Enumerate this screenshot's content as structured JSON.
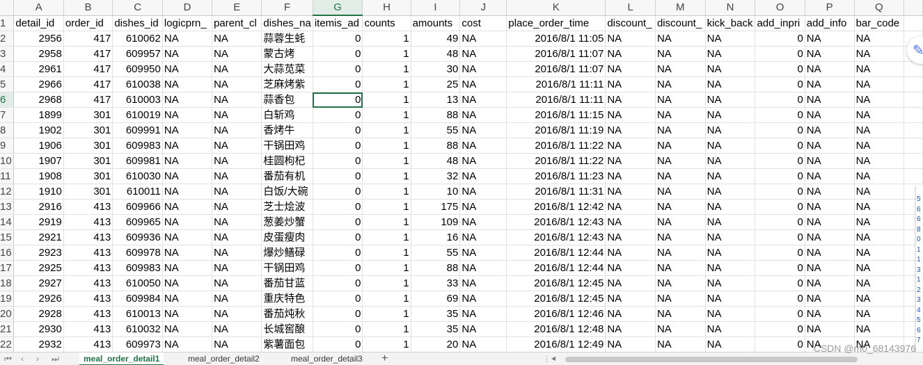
{
  "columns": [
    "A",
    "B",
    "C",
    "D",
    "E",
    "F",
    "G",
    "H",
    "I",
    "J",
    "K",
    "L",
    "M",
    "N",
    "O",
    "P",
    "Q"
  ],
  "active_column": "G",
  "headers": [
    "detail_id",
    "order_id",
    "dishes_id",
    "logicprn_",
    "parent_cl",
    "dishes_na",
    "itemis_ad",
    "counts",
    "amounts",
    "cost",
    "place_order_time",
    "discount_",
    "discount_",
    "kick_back",
    "add_inpri",
    "add_info",
    "bar_code"
  ],
  "rows": [
    {
      "n": "2",
      "cells": [
        "2956",
        "417",
        "610062",
        "NA",
        "NA",
        "蒜蓉生蚝",
        "0",
        "1",
        "49",
        "NA",
        "2016/8/1 11:05",
        "NA",
        "NA",
        "NA",
        "0",
        "NA",
        "NA"
      ]
    },
    {
      "n": "3",
      "cells": [
        "2958",
        "417",
        "609957",
        "NA",
        "NA",
        "蒙古烤",
        "0",
        "1",
        "48",
        "NA",
        "2016/8/1 11:07",
        "NA",
        "NA",
        "NA",
        "0",
        "NA",
        "NA"
      ]
    },
    {
      "n": "4",
      "cells": [
        "2961",
        "417",
        "609950",
        "NA",
        "NA",
        "大蒜苋菜",
        "0",
        "1",
        "30",
        "NA",
        "2016/8/1 11:07",
        "NA",
        "NA",
        "NA",
        "0",
        "NA",
        "NA"
      ]
    },
    {
      "n": "5",
      "cells": [
        "2966",
        "417",
        "610038",
        "NA",
        "NA",
        "芝麻烤紫",
        "0",
        "1",
        "25",
        "NA",
        "2016/8/1 11:11",
        "NA",
        "NA",
        "NA",
        "0",
        "NA",
        "NA"
      ]
    },
    {
      "n": "6",
      "cells": [
        "2968",
        "417",
        "610003",
        "NA",
        "NA",
        "蒜香包",
        "0",
        "1",
        "13",
        "NA",
        "2016/8/1 11:11",
        "NA",
        "NA",
        "NA",
        "0",
        "NA",
        "NA"
      ]
    },
    {
      "n": "7",
      "cells": [
        "1899",
        "301",
        "610019",
        "NA",
        "NA",
        "白斩鸡",
        "0",
        "1",
        "88",
        "NA",
        "2016/8/1 11:15",
        "NA",
        "NA",
        "NA",
        "0",
        "NA",
        "NA"
      ]
    },
    {
      "n": "8",
      "cells": [
        "1902",
        "301",
        "609991",
        "NA",
        "NA",
        "香烤牛",
        "0",
        "1",
        "55",
        "NA",
        "2016/8/1 11:19",
        "NA",
        "NA",
        "NA",
        "0",
        "NA",
        "NA"
      ]
    },
    {
      "n": "9",
      "cells": [
        "1906",
        "301",
        "609983",
        "NA",
        "NA",
        "干锅田鸡",
        "0",
        "1",
        "88",
        "NA",
        "2016/8/1 11:22",
        "NA",
        "NA",
        "NA",
        "0",
        "NA",
        "NA"
      ]
    },
    {
      "n": "10",
      "cells": [
        "1907",
        "301",
        "609981",
        "NA",
        "NA",
        "桂圆枸杞",
        "0",
        "1",
        "48",
        "NA",
        "2016/8/1 11:22",
        "NA",
        "NA",
        "NA",
        "0",
        "NA",
        "NA"
      ]
    },
    {
      "n": "11",
      "cells": [
        "1908",
        "301",
        "610030",
        "NA",
        "NA",
        "番茄有机",
        "0",
        "1",
        "32",
        "NA",
        "2016/8/1 11:23",
        "NA",
        "NA",
        "NA",
        "0",
        "NA",
        "NA"
      ]
    },
    {
      "n": "12",
      "cells": [
        "1910",
        "301",
        "610011",
        "NA",
        "NA",
        "白饭/大碗",
        "0",
        "1",
        "10",
        "NA",
        "2016/8/1 11:31",
        "NA",
        "NA",
        "NA",
        "0",
        "NA",
        "NA"
      ]
    },
    {
      "n": "13",
      "cells": [
        "2916",
        "413",
        "609966",
        "NA",
        "NA",
        "芝士烩波",
        "0",
        "1",
        "175",
        "NA",
        "2016/8/1 12:42",
        "NA",
        "NA",
        "NA",
        "0",
        "NA",
        "NA"
      ]
    },
    {
      "n": "14",
      "cells": [
        "2919",
        "413",
        "609965",
        "NA",
        "NA",
        "葱姜炒蟹",
        "0",
        "1",
        "109",
        "NA",
        "2016/8/1 12:43",
        "NA",
        "NA",
        "NA",
        "0",
        "NA",
        "NA"
      ]
    },
    {
      "n": "15",
      "cells": [
        "2921",
        "413",
        "609936",
        "NA",
        "NA",
        "皮蛋瘦肉",
        "0",
        "1",
        "16",
        "NA",
        "2016/8/1 12:43",
        "NA",
        "NA",
        "NA",
        "0",
        "NA",
        "NA"
      ]
    },
    {
      "n": "16",
      "cells": [
        "2923",
        "413",
        "609978",
        "NA",
        "NA",
        "爆炒鳝碌",
        "0",
        "1",
        "55",
        "NA",
        "2016/8/1 12:44",
        "NA",
        "NA",
        "NA",
        "0",
        "NA",
        "NA"
      ]
    },
    {
      "n": "17",
      "cells": [
        "2925",
        "413",
        "609983",
        "NA",
        "NA",
        "干锅田鸡",
        "0",
        "1",
        "88",
        "NA",
        "2016/8/1 12:44",
        "NA",
        "NA",
        "NA",
        "0",
        "NA",
        "NA"
      ]
    },
    {
      "n": "18",
      "cells": [
        "2927",
        "413",
        "610050",
        "NA",
        "NA",
        "番茄甘蓝",
        "0",
        "1",
        "33",
        "NA",
        "2016/8/1 12:45",
        "NA",
        "NA",
        "NA",
        "0",
        "NA",
        "NA"
      ]
    },
    {
      "n": "19",
      "cells": [
        "2926",
        "413",
        "609984",
        "NA",
        "NA",
        "重庆特色",
        "0",
        "1",
        "69",
        "NA",
        "2016/8/1 12:45",
        "NA",
        "NA",
        "NA",
        "0",
        "NA",
        "NA"
      ]
    },
    {
      "n": "20",
      "cells": [
        "2928",
        "413",
        "610013",
        "NA",
        "NA",
        "番茄炖秋",
        "0",
        "1",
        "35",
        "NA",
        "2016/8/1 12:46",
        "NA",
        "NA",
        "NA",
        "0",
        "NA",
        "NA"
      ]
    },
    {
      "n": "21",
      "cells": [
        "2930",
        "413",
        "610032",
        "NA",
        "NA",
        "长城窖酿",
        "0",
        "1",
        "35",
        "NA",
        "2016/8/1 12:48",
        "NA",
        "NA",
        "NA",
        "0",
        "NA",
        "NA"
      ]
    },
    {
      "n": "22",
      "cells": [
        "2932",
        "413",
        "609973",
        "NA",
        "NA",
        "紫薯面包",
        "0",
        "1",
        "20",
        "NA",
        "2016/8/1 12:49",
        "NA",
        "NA",
        "NA",
        "0",
        "NA",
        "NA"
      ]
    }
  ],
  "header_row_num": "1",
  "selected_row": "6",
  "selected_col_index": 6,
  "sheet_tabs": [
    "meal_order_detail1",
    "meal_order_detail2",
    "meal_order_detail3"
  ],
  "active_tab": "meal_order_detail1",
  "add_tab_label": "+",
  "watermark": "CSDN @m0_68143976",
  "side_digits": [
    "5",
    "6",
    "6",
    "8",
    "0",
    "1",
    "1",
    "3",
    "1",
    "2",
    "3",
    "4",
    "5",
    "6",
    "7"
  ],
  "colors": {
    "accent": "#217346",
    "header_bg": "#f7f7f7"
  },
  "icons": {
    "nav_first": "⏮",
    "nav_prev": "‹",
    "nav_next": "›",
    "nav_last": "⏭",
    "float": "✎"
  }
}
